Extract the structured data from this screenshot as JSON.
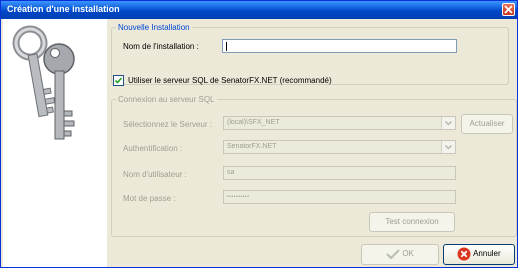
{
  "window": {
    "title": "Création d'une installation"
  },
  "new_install": {
    "legend": "Nouvelle Installation",
    "name_label": "Nom de l'installation :",
    "name_value": ""
  },
  "use_sql": {
    "label": "Utiliser le serveur SQL de SenatorFX.NET (recommandé)",
    "checked": true
  },
  "connection": {
    "legend": "Connexion au serveur SQL",
    "server_label": "Sélectionnez le Serveur :",
    "server_value": "(local)\\SFX_NET",
    "refresh_label": "Actualiser",
    "auth_label": "Authentification :",
    "auth_value": "SenatorFX.NET",
    "user_label": "Nom d'utilisateur :",
    "user_value": "sa",
    "password_label": "Mot de passe :",
    "password_value": "••••••••••",
    "test_label": "Test connexion"
  },
  "footer": {
    "ok_label": "OK",
    "cancel_label": "Annuler"
  },
  "colors": {
    "titlebar": "#0a5ad8",
    "close_button": "#c5361c"
  }
}
